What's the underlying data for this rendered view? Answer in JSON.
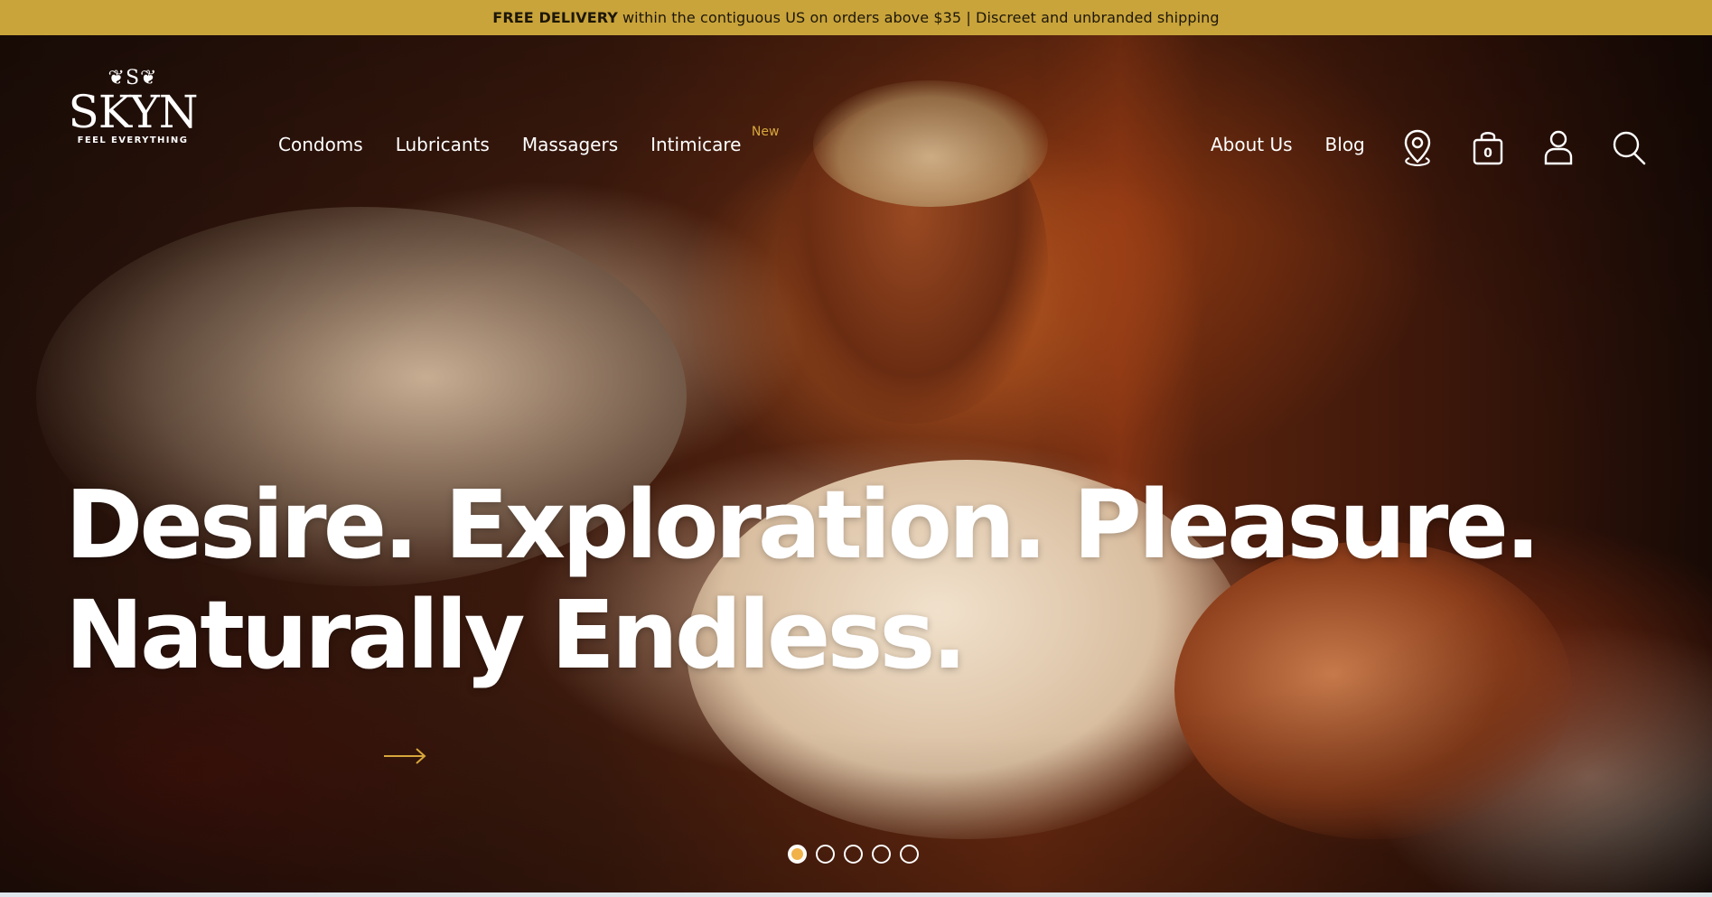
{
  "announcement": {
    "strong": "FREE DELIVERY",
    "text": "within the contiguous US on orders above $35 | Discreet and unbranded shipping",
    "background": "#c9a43b"
  },
  "logo": {
    "wordmark": "SKYN",
    "tagline": "FEEL EVERYTHING"
  },
  "nav": {
    "items": [
      {
        "label": "Condoms"
      },
      {
        "label": "Lubricants"
      },
      {
        "label": "Massagers"
      },
      {
        "label": "Intimicare",
        "badge": "New"
      }
    ],
    "right_items": [
      {
        "label": "About Us"
      },
      {
        "label": "Blog"
      }
    ],
    "icons": [
      "location-icon",
      "shopping-bag-icon",
      "user-icon",
      "search-icon"
    ],
    "cart_count": "0"
  },
  "hero": {
    "headline_line1": "Desire. Exploration. Pleasure.",
    "headline_line2": "Naturally Endless.",
    "accent_color": "#d7a73c"
  },
  "carousel": {
    "slide_count": 5,
    "active_index": 0,
    "active_color": "#f1b24a"
  }
}
